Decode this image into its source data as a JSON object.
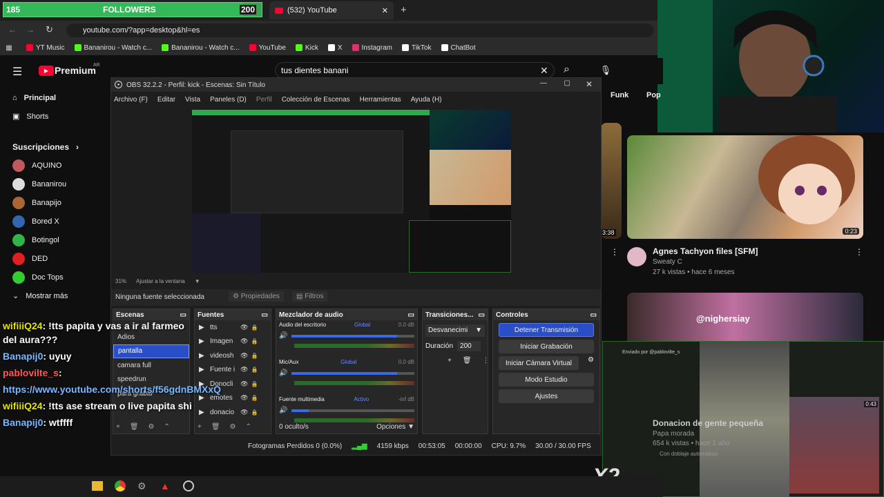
{
  "followers_bar": {
    "current": "185",
    "label": "FOLLOWERS",
    "goal": "200",
    "progress_fraction": 0.925
  },
  "browser": {
    "tab_title": "(532) YouTube",
    "url": "youtube.com/?app=desktop&hl=es",
    "bookmarks": [
      {
        "label": "YT Music",
        "color": "#ff0033"
      },
      {
        "label": "Bananirou - Watch c...",
        "color": "#53fc18"
      },
      {
        "label": "Bananirou - Watch c...",
        "color": "#53fc18"
      },
      {
        "label": "YouTube",
        "color": "#ff0033"
      },
      {
        "label": "Kick",
        "color": "#53fc18"
      },
      {
        "label": "X",
        "color": "#ffffff"
      },
      {
        "label": "Instagram",
        "color": "#e1306c"
      },
      {
        "label": "TikTok",
        "color": "#ffffff"
      },
      {
        "label": "ChatBot",
        "color": "#ffffff"
      }
    ]
  },
  "youtube": {
    "logo": "Premium",
    "logo_region": "AR",
    "search_query": "tus dientes banani",
    "nav": [
      {
        "label": "Principal"
      },
      {
        "label": "Shorts"
      }
    ],
    "subscriptions_label": "Suscripciones",
    "subscriptions": [
      {
        "label": "AQUINO",
        "color": "#c05a5a"
      },
      {
        "label": "Bananirou",
        "color": "#dddddd"
      },
      {
        "label": "Banapijo",
        "color": "#aa6633"
      },
      {
        "label": "Bored X",
        "color": "#3366aa"
      },
      {
        "label": "Botingol",
        "color": "#2fb34a"
      },
      {
        "label": "DED",
        "color": "#e02020"
      },
      {
        "label": "Doc Tops",
        "color": "#33cc33"
      }
    ],
    "show_more": "Mostrar más",
    "chips": [
      "Funk",
      "Pop"
    ],
    "videos": [
      {
        "title": "Agnes Tachyon files [SFM]",
        "channel": "Sweaty C",
        "meta": "27 k vistas • hace 6 meses",
        "duration": "0:23"
      },
      {
        "title": "Donacion de gente pequeña",
        "channel": "Papa morada",
        "meta": "654 k vistas • hace 1 año",
        "duration": "0:43",
        "badge": "Con doblaje automático"
      }
    ],
    "left_partial": {
      "duration": "3:38"
    },
    "overlay_tag": "@nighersiay",
    "sent_by": "Enviado por @pablovilte_s",
    "x2": "X2"
  },
  "obs": {
    "title": "OBS 32.2.2 - Perfil: kick - Escenas: Sin Título",
    "menu": [
      "Archivo (F)",
      "Editar",
      "Vista",
      "Paneles (D)",
      "Perfil",
      "Colección de Escenas",
      "Herramientas",
      "Ayuda (H)"
    ],
    "zoom": "31%",
    "fit_label": "Ajustar a la ventana",
    "no_source": "Ninguna fuente seleccionada",
    "properties": "Propiedades",
    "filters": "Filtros",
    "scenes_title": "Escenas",
    "scenes": [
      "Adios",
      "pantalla",
      "camara full",
      "speedrun",
      "para grabar"
    ],
    "selected_scene": "pantalla",
    "sources_title": "Fuentes",
    "sources": [
      "tts",
      "Imagen",
      "videosh",
      "Fuente i",
      "Donocli",
      "emotes",
      "donacio"
    ],
    "mixer_title": "Mezclador de audio",
    "mixer": [
      {
        "name": "Audio del escritorio",
        "tag": "Global",
        "db": "0.0 dB",
        "level": 0.86
      },
      {
        "name": "Mic/Aux",
        "tag": "Global",
        "db": "0.0 dB",
        "level": 0.86
      },
      {
        "name": "Fuente multimedia",
        "tag": "Activo",
        "db": "-inf dB",
        "level": 0.14
      }
    ],
    "mixer_footer": "0 oculto/s",
    "options": "Opciones",
    "transitions_title": "Transiciones...",
    "transition": "Desvanecimi",
    "duration_label": "Duración",
    "duration_value": "200",
    "controls_title": "Controles",
    "controls": [
      "Detener Transmisión",
      "Iniciar Grabación",
      "Iniciar Cámara Virtual",
      "Modo Estudio",
      "Ajustes"
    ],
    "status": {
      "dropped": "Fotogramas Perdidos 0 (0.0%)",
      "bitrate": "4159 kbps",
      "stream_time": "00:53:05",
      "rec_time": "00:00:00",
      "cpu": "CPU: 9.7%",
      "fps": "30.00 / 30.00 FPS"
    }
  },
  "chat": [
    {
      "user": "wifiiiQ24",
      "text": ": !tts papita y vas a ir al farmeo del aura???",
      "color": "#e6e600"
    },
    {
      "user": "Banapij0",
      "text": ": uyuy",
      "color": "#7ab8ff"
    },
    {
      "user": "pablovilte_s",
      "text": ":",
      "color": "#ff5a5a"
    },
    {
      "user": "",
      "text": "https://www.youtube.com/shorts/f56gdnBMXxQ",
      "color": "#7ab8ff"
    },
    {
      "user": "wifiiiQ24",
      "text": ": !tts ase stream o live papita shi",
      "color": "#e6e600"
    },
    {
      "user": "Banapij0",
      "text": ": wtffff",
      "color": "#7ab8ff"
    }
  ],
  "colors": {
    "accent_blue": "#2a4ec8",
    "yt_red": "#ff0033",
    "kick_green": "#53fc18"
  }
}
